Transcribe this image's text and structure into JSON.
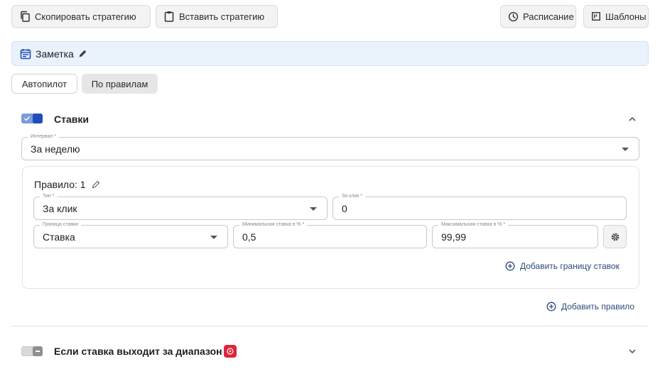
{
  "toolbar": {
    "copy_label": "Скопировать стратегию",
    "paste_label": "Вставить стратегию",
    "schedule_label": "Расписание",
    "templates_label": "Шаблоны"
  },
  "note": {
    "label": "Заметка"
  },
  "modes": {
    "autopilot_label": "Автопилот",
    "rules_label": "По правилам",
    "selected": "rules"
  },
  "bids": {
    "title": "Ставки",
    "enabled": true,
    "interval": {
      "label": "Интервал *",
      "value": "За неделю"
    },
    "rule": {
      "title": "Правило: 1",
      "type": {
        "label": "Тип *",
        "value": "За клик"
      },
      "per_click": {
        "label": "За клик *",
        "value": "0"
      },
      "bid_limit": {
        "label": "Граница ставки",
        "value": "Ставка"
      },
      "min_bid": {
        "label": "Минимальная ставка в % *",
        "value": "0,5"
      },
      "max_bid": {
        "label": "Максимальная ставка в % *",
        "value": "99,99"
      },
      "add_limit_label": "Добавить границу ставок"
    },
    "add_rule_label": "Добавить правило"
  },
  "out_of_range": {
    "title": "Если ставка выходит за диапазон",
    "enabled": false
  },
  "colors": {
    "accent": "#1f4db8",
    "toggle_on_track": "#7c9bd9",
    "toggle_off_track": "#d9d9d9",
    "note_bg": "#eaf2fb",
    "link": "#2b4a78",
    "badge": "#e0243a"
  }
}
